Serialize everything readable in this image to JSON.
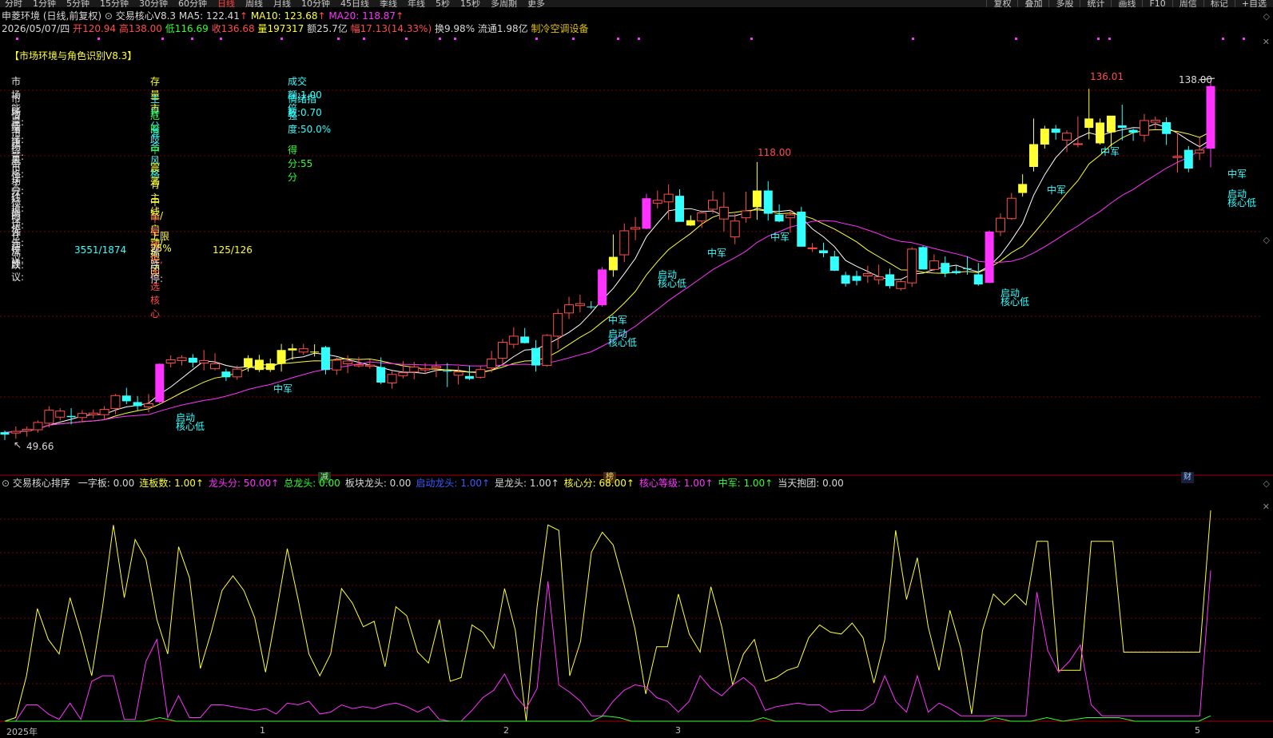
{
  "toolbar": {
    "period_tabs": [
      {
        "label": "分时",
        "active": false
      },
      {
        "label": "1分钟",
        "active": false
      },
      {
        "label": "5分钟",
        "active": false
      },
      {
        "label": "15分钟",
        "active": false
      },
      {
        "label": "30分钟",
        "active": false
      },
      {
        "label": "60分钟",
        "active": false
      },
      {
        "label": "日线",
        "active": true
      },
      {
        "label": "周线",
        "active": false
      },
      {
        "label": "月线",
        "active": false
      },
      {
        "label": "10分钟",
        "active": false
      },
      {
        "label": "45日线",
        "active": false
      },
      {
        "label": "季线",
        "active": false
      },
      {
        "label": "年线",
        "active": false
      },
      {
        "label": "5秒",
        "active": false
      },
      {
        "label": "15秒",
        "active": false
      },
      {
        "label": "多周期",
        "active": false
      },
      {
        "label": "更多",
        "active": false
      }
    ],
    "right_tools": [
      "复权",
      "叠加",
      "多股",
      "统计",
      "画线",
      "F10",
      "周信",
      "标记",
      "+自选"
    ]
  },
  "header": {
    "stock": "申菱环境",
    "mode": "(日线,前复权)",
    "indicator": "交易核心V8.3",
    "ma5_label": "MA5: 122.41",
    "ma10_label": "MA10: 123.68",
    "ma20_label": "MA20: 118.87",
    "arrow": "↑"
  },
  "quote": {
    "date": "2026/05/07/四",
    "open_label": "开",
    "open": "120.94",
    "high_label": "高",
    "high": "138.00",
    "low_label": "低",
    "low": "116.69",
    "close_label": "收",
    "close": "136.68",
    "vol_label": "量",
    "vol": "197317",
    "amount": "额25.7亿",
    "range_label": "幅",
    "range": "17.13(14.33%)",
    "turnover": "换9.98%",
    "float_cap": "流通1.98亿",
    "sector": "制冷空调设备"
  },
  "panel": {
    "title": "【市场环境与角色识别V8.3】",
    "rows": [
      {
        "label": "市场能量:",
        "value": "存量市",
        "value_color": "#ffff33",
        "extra": "成交额:1.00倍",
        "extra_color": "#33ffff"
      },
      {
        "label": "市场情绪:",
        "value": "主升分歧",
        "value_color": "#33ffff",
        "extra": "情绪指数:0.70",
        "extra_color": "#33ffff"
      },
      {
        "label": "情绪质量:",
        "value": "危险",
        "value_color": "#33ff33",
        "extra": "强度:50.0%",
        "extra_color": "#33ffff"
      },
      {
        "label": "市场风格:",
        "value": "混合风格",
        "value_color": "#33ffff",
        "extra": "",
        "extra_color": "#33ffff"
      },
      {
        "label": "综合评分:",
        "value": "中",
        "value_color": "#33ff33",
        "extra": "得分:55分",
        "extra_color": "#33ff33"
      },
      {
        "label": "市场环境:",
        "value": "震荡",
        "value_color": "#ffff33",
        "extra": "",
        "extra_color": "#33ffff"
      },
      {
        "label": "主线板块:",
        "value": "有主线",
        "value_color": "#ffff33",
        "extra": "",
        "extra_color": "#33ffff"
      },
      {
        "label": "标的优先:",
        "value": "中军/启动/抱团",
        "value_color": "#ffff33",
        "extra": "",
        "extra_color": "#33ffff"
      },
      {
        "label": "操作建议:",
        "value": "中军优先, 次选核心",
        "value_color": "#ff4d4d",
        "extra": "",
        "extra_color": "#33ffff"
      },
      {
        "label": "仓位建议:",
        "value": "上限25%",
        "value_color": "#ffff33",
        "extra": "",
        "extra_color": "#33ffff"
      }
    ],
    "zd_label": "涨跌:",
    "zd_value": "3551/1874",
    "zdt_label": "涨跌停:",
    "zdt_value": "125/126"
  },
  "price_marks": {
    "max1": "136.01",
    "max2": "138.00",
    "mid": "118.00",
    "min": "49.66"
  },
  "signal_texts": {
    "zhongjun": "中军",
    "qidong": "启动",
    "hexindi": "核心低"
  },
  "event_tags": {
    "jian": "减",
    "bang": "榜",
    "cai": "财"
  },
  "indicator": {
    "name": "交易核心排序",
    "items": [
      {
        "text": "一字板: 0.00",
        "color": "#d8d8d8"
      },
      {
        "text": "连板数: 1.00↑",
        "color": "#ffff33"
      },
      {
        "text": "龙头分: 50.00↑",
        "color": "#ff33ff"
      },
      {
        "text": "总龙头: 0.00",
        "color": "#33ff33"
      },
      {
        "text": "板块龙头: 0.00",
        "color": "#d8d8d8"
      },
      {
        "text": "启动龙头: 1.00↑",
        "color": "#3a5cff"
      },
      {
        "text": "是龙头: 1.00↑",
        "color": "#d8d8d8"
      },
      {
        "text": "核心分: 68.00↑",
        "color": "#ffff33"
      },
      {
        "text": "核心等级: 1.00↑",
        "color": "#ff33ff"
      },
      {
        "text": "中军: 1.00↑",
        "color": "#33ff33"
      },
      {
        "text": "当天抱团: 0.00",
        "color": "#d8d8d8"
      }
    ]
  },
  "date_axis": [
    "2025年",
    "1",
    "2",
    "3",
    "5"
  ],
  "colors": {
    "up": "#ff4d4d",
    "down": "#33ffff",
    "strong": "#ff33ff",
    "hot": "#ffff33",
    "ma5": "#ffffff",
    "ma10": "#ffff33",
    "ma20": "#ff33ff",
    "grid": "#7a0000"
  },
  "chart_data": {
    "type": "candlestick",
    "ylim": [
      45,
      142
    ],
    "candles": [
      [
        51,
        52,
        49.66,
        51.6,
        "down"
      ],
      [
        51.4,
        53,
        50,
        51.8,
        "up"
      ],
      [
        51.9,
        53,
        50.5,
        52.3,
        "up"
      ],
      [
        52.2,
        54.5,
        51.5,
        54,
        "up"
      ],
      [
        53.8,
        58,
        52.8,
        57,
        "up"
      ],
      [
        56.8,
        57.5,
        54.5,
        55.3,
        "up"
      ],
      [
        55.6,
        57.5,
        53.5,
        55.3,
        "down"
      ],
      [
        55.2,
        57,
        54,
        56.2,
        "up"
      ],
      [
        56.3,
        57.2,
        55,
        55.9,
        "up"
      ],
      [
        55.9,
        58,
        54.8,
        57.2,
        "up"
      ],
      [
        57.4,
        61,
        56,
        60.6,
        "up"
      ],
      [
        60.6,
        62.5,
        58.5,
        59.2,
        "down"
      ],
      [
        59,
        60.5,
        57,
        58,
        "down"
      ],
      [
        57.8,
        61,
        56.5,
        58.6,
        "up"
      ],
      [
        59,
        68.5,
        58.5,
        68.4,
        "strong"
      ],
      [
        68.6,
        70.5,
        67.5,
        69.4,
        "up"
      ],
      [
        69.2,
        70.5,
        68,
        69.9,
        "up"
      ],
      [
        69.9,
        70.8,
        67.5,
        68.7,
        "down"
      ],
      [
        68.6,
        71.8,
        66.8,
        69.2,
        "up"
      ],
      [
        68.4,
        71,
        66.8,
        67.2,
        "up"
      ],
      [
        66.5,
        67.2,
        64.2,
        65.1,
        "down"
      ],
      [
        65.2,
        68,
        64.5,
        67.1,
        "up"
      ],
      [
        67.5,
        70.5,
        66.5,
        69.8,
        "hot"
      ],
      [
        69.4,
        70.6,
        66.4,
        66.9,
        "hot"
      ],
      [
        66.9,
        69.7,
        66.4,
        68.5,
        "hot"
      ],
      [
        68.5,
        73.3,
        66.5,
        71.8,
        "hot"
      ],
      [
        71.7,
        73.3,
        69.4,
        72.2,
        "hot"
      ],
      [
        72.1,
        73.3,
        70.6,
        71.3,
        "up"
      ],
      [
        71.2,
        73.2,
        70.2,
        71.4,
        "hot"
      ],
      [
        72.5,
        72.8,
        65.8,
        66.9,
        "down"
      ],
      [
        66.9,
        70,
        65.7,
        69.3,
        "up"
      ],
      [
        69.1,
        70.5,
        66.1,
        68.4,
        "up"
      ],
      [
        68.2,
        70.1,
        67.5,
        67.9,
        "up"
      ],
      [
        67.8,
        69.5,
        67.2,
        68.1,
        "up"
      ],
      [
        67.6,
        70,
        63.4,
        63.8,
        "down"
      ],
      [
        63.7,
        66.6,
        62.3,
        65.8,
        "up"
      ],
      [
        65.5,
        69.1,
        64.8,
        66.2,
        "up"
      ],
      [
        66.4,
        68.9,
        64.6,
        67.6,
        "up"
      ],
      [
        67.2,
        68.6,
        65.8,
        66.9,
        "up"
      ],
      [
        67.8,
        69,
        65.1,
        67.4,
        "up"
      ],
      [
        66.7,
        68.6,
        62.7,
        66.6,
        "down"
      ],
      [
        66.4,
        67.8,
        63.3,
        65.6,
        "up"
      ],
      [
        64.7,
        68,
        64.4,
        65.4,
        "down"
      ],
      [
        65.1,
        67.9,
        64.8,
        67,
        "up"
      ],
      [
        67.4,
        71.6,
        66.3,
        69.6,
        "up"
      ],
      [
        69.8,
        74.5,
        68.1,
        73.7,
        "up"
      ],
      [
        73.2,
        77.4,
        72.2,
        75.2,
        "up"
      ],
      [
        75.1,
        77.2,
        73.4,
        73.5,
        "down"
      ],
      [
        72.3,
        74.2,
        66.5,
        68,
        "down"
      ],
      [
        68,
        75.7,
        67.7,
        75.4,
        "up"
      ],
      [
        75.2,
        81.9,
        72.1,
        80.8,
        "up"
      ],
      [
        80.9,
        84.9,
        79.4,
        82.9,
        "up"
      ],
      [
        82.7,
        85.4,
        81.1,
        83.2,
        "up"
      ],
      [
        82.5,
        83.8,
        81.9,
        82.3,
        "down"
      ],
      [
        82.8,
        92.2,
        82.4,
        91.6,
        "strong"
      ],
      [
        91.4,
        100.2,
        89.8,
        94.7,
        "hot"
      ],
      [
        95.2,
        102.9,
        93.4,
        101.1,
        "up"
      ],
      [
        101.5,
        104.5,
        98.8,
        101.9,
        "up"
      ],
      [
        101.6,
        110.2,
        101.5,
        109.1,
        "strong"
      ],
      [
        108.6,
        111,
        106.6,
        107.9,
        "up"
      ],
      [
        108.2,
        112.5,
        103.8,
        110.1,
        "up"
      ],
      [
        109.7,
        111.3,
        103.7,
        103.3,
        "down"
      ],
      [
        103.7,
        104.9,
        102.3,
        102.4,
        "hot"
      ],
      [
        103.5,
        106.1,
        101.8,
        105.5,
        "up"
      ],
      [
        106.4,
        110.9,
        105.3,
        108.6,
        "up"
      ],
      [
        106.9,
        110.6,
        100.9,
        104,
        "up"
      ],
      [
        99.6,
        105.3,
        97.8,
        103.5,
        "up"
      ],
      [
        104.3,
        110.7,
        103.1,
        106,
        "up"
      ],
      [
        106.9,
        118,
        103.8,
        111,
        "hot"
      ],
      [
        111,
        113.3,
        103.6,
        105.3,
        "down"
      ],
      [
        105.1,
        107.6,
        103.2,
        103.4,
        "down"
      ],
      [
        104.3,
        106.3,
        100.6,
        105,
        "up"
      ],
      [
        105.8,
        107,
        97.7,
        97.2,
        "down"
      ],
      [
        96.8,
        98.1,
        95.9,
        96.9,
        "up"
      ],
      [
        96.3,
        98.2,
        94.6,
        95.6,
        "down"
      ],
      [
        94.8,
        96.2,
        91.2,
        91.3,
        "down"
      ],
      [
        90.2,
        91,
        87.4,
        88.1,
        "down"
      ],
      [
        88.8,
        91.3,
        87.7,
        90,
        "down"
      ],
      [
        90,
        92.5,
        88.3,
        90.6,
        "up"
      ],
      [
        89.8,
        92.8,
        87.9,
        89.1,
        "up"
      ],
      [
        90.4,
        91.8,
        86.9,
        87.5,
        "down"
      ],
      [
        86.9,
        89,
        86.4,
        88.6,
        "up"
      ],
      [
        88.3,
        97.1,
        87.3,
        96.6,
        "up"
      ],
      [
        97.1,
        97.4,
        91.6,
        91.6,
        "down"
      ],
      [
        91.6,
        95.3,
        91.2,
        93.7,
        "up"
      ],
      [
        93.2,
        94.8,
        89.7,
        90.7,
        "down"
      ],
      [
        91.2,
        92.5,
        90.4,
        90.7,
        "down"
      ],
      [
        91.8,
        94.8,
        90.3,
        91.9,
        "down"
      ],
      [
        90.4,
        93.2,
        87.6,
        87.9,
        "down"
      ],
      [
        88.3,
        101.2,
        88.3,
        100.9,
        "strong"
      ],
      [
        100.9,
        105.4,
        99.8,
        104.2,
        "up"
      ],
      [
        104.1,
        110.4,
        103.8,
        109.1,
        "up"
      ],
      [
        110.4,
        115,
        109.5,
        112.6,
        "hot"
      ],
      [
        116.8,
        128.7,
        115.7,
        122.4,
        "hot"
      ],
      [
        122.3,
        126.9,
        121.3,
        126.2,
        "hot"
      ],
      [
        126.2,
        127.1,
        123.5,
        125.2,
        "down"
      ],
      [
        125.1,
        125.8,
        120.5,
        123.4,
        "up"
      ],
      [
        122.5,
        129.2,
        121.6,
        122.5,
        "up"
      ],
      [
        126.4,
        136.01,
        123.6,
        128.7,
        "hot"
      ],
      [
        127.7,
        128.7,
        122.3,
        122.6,
        "hot"
      ],
      [
        125.3,
        129,
        121.8,
        129.4,
        "hot"
      ],
      [
        127,
        132.1,
        123.3,
        126.4,
        "down"
      ],
      [
        125.9,
        126.2,
        123.2,
        125.2,
        "down"
      ],
      [
        124.6,
        129.8,
        123,
        128.2,
        "up"
      ],
      [
        128.3,
        129.2,
        126.1,
        127.8,
        "up"
      ],
      [
        127.8,
        129,
        122.2,
        124.9,
        "down"
      ],
      [
        119.1,
        125.3,
        115.4,
        119.4,
        "up"
      ],
      [
        121,
        121.9,
        115.5,
        116.4,
        "down"
      ],
      [
        120.94,
        124,
        118.5,
        120.2,
        "up"
      ],
      [
        121.3,
        138,
        116.69,
        136.68,
        "strong"
      ]
    ]
  }
}
